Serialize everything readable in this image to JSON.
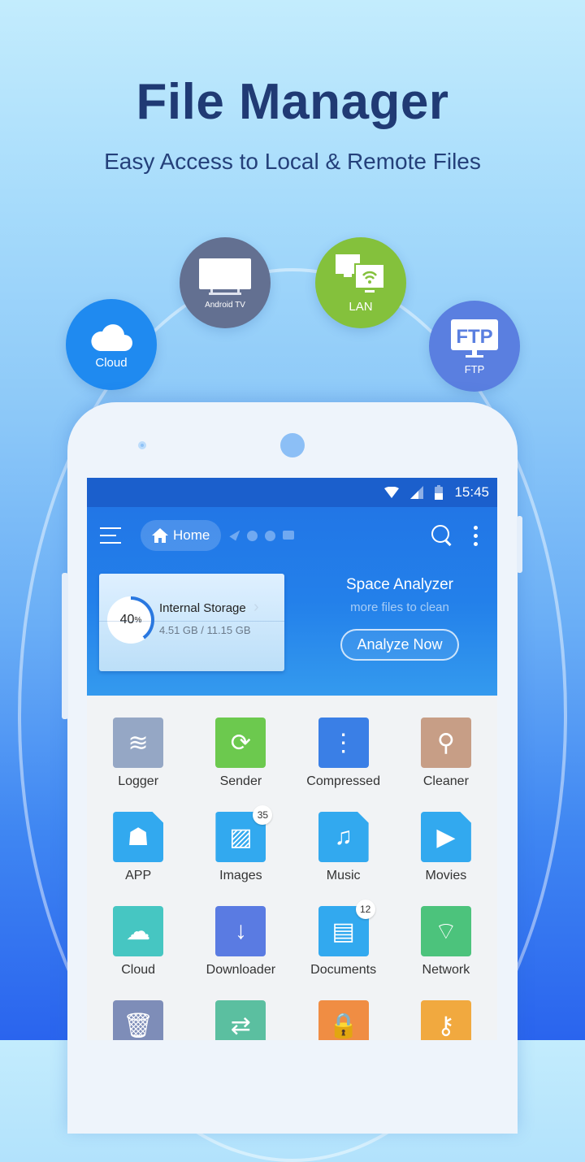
{
  "promo": {
    "title": "File Manager",
    "subtitle": "Easy Access to Local & Remote Files"
  },
  "features": [
    {
      "label": "Cloud",
      "icon": "cloud-icon",
      "color": "#1f8af0"
    },
    {
      "label": "Android TV",
      "icon": "tv-icon",
      "color": "#637091"
    },
    {
      "label": "LAN",
      "icon": "lan-icon",
      "color": "#84c13c"
    },
    {
      "label": "FTP",
      "icon": "ftp-icon",
      "color": "#5a7fe0",
      "glyph": "FTP"
    }
  ],
  "statusbar": {
    "time": "15:45"
  },
  "toolbar": {
    "breadcrumb": "Home"
  },
  "storage": {
    "percent_label": "40",
    "percent_sign": "%",
    "used_fraction": 0.4,
    "title": "Internal Storage",
    "chevron": "›",
    "size": "4.51 GB / 11.15 GB"
  },
  "analyzer": {
    "title": "Space Analyzer",
    "subtitle": "more files to clean",
    "button": "Analyze Now"
  },
  "categories": [
    {
      "label": "Logger",
      "icon": "logger-icon",
      "color": "#95a7c5",
      "glyph": "≋"
    },
    {
      "label": "Sender",
      "icon": "sender-icon",
      "color": "#6cc94e",
      "glyph": "⟳"
    },
    {
      "label": "Compressed",
      "icon": "zip-icon",
      "color": "#3a7fe6",
      "glyph": "⋮"
    },
    {
      "label": "Cleaner",
      "icon": "broom-icon",
      "color": "#c79e86",
      "glyph": "⚲"
    },
    {
      "label": "APP",
      "icon": "android-icon",
      "color": "#32a9ef",
      "glyph": "☗"
    },
    {
      "label": "Images",
      "icon": "image-icon",
      "color": "#32a9ef",
      "glyph": "▨",
      "badge": "35"
    },
    {
      "label": "Music",
      "icon": "music-icon",
      "color": "#32a9ef",
      "glyph": "♫"
    },
    {
      "label": "Movies",
      "icon": "video-icon",
      "color": "#32a9ef",
      "glyph": "▶"
    },
    {
      "label": "Cloud",
      "icon": "cloud-icon",
      "color": "#46c6c2",
      "glyph": "☁"
    },
    {
      "label": "Downloader",
      "icon": "download-icon",
      "color": "#5a7be2",
      "glyph": "↓"
    },
    {
      "label": "Documents",
      "icon": "document-icon",
      "color": "#32a9ef",
      "glyph": "▤",
      "badge": "12"
    },
    {
      "label": "Network",
      "icon": "router-icon",
      "color": "#4cc37c",
      "glyph": "⌔"
    },
    {
      "label": "",
      "icon": "trash-icon",
      "color": "#7e8db8",
      "glyph": "🗑"
    },
    {
      "label": "",
      "icon": "transfer-icon",
      "color": "#5bbfa0",
      "glyph": "⇄"
    },
    {
      "label": "",
      "icon": "lock-icon",
      "color": "#f08d43",
      "glyph": "🔒"
    },
    {
      "label": "",
      "icon": "encrypt-icon",
      "color": "#f1a93f",
      "glyph": "⚷"
    }
  ]
}
